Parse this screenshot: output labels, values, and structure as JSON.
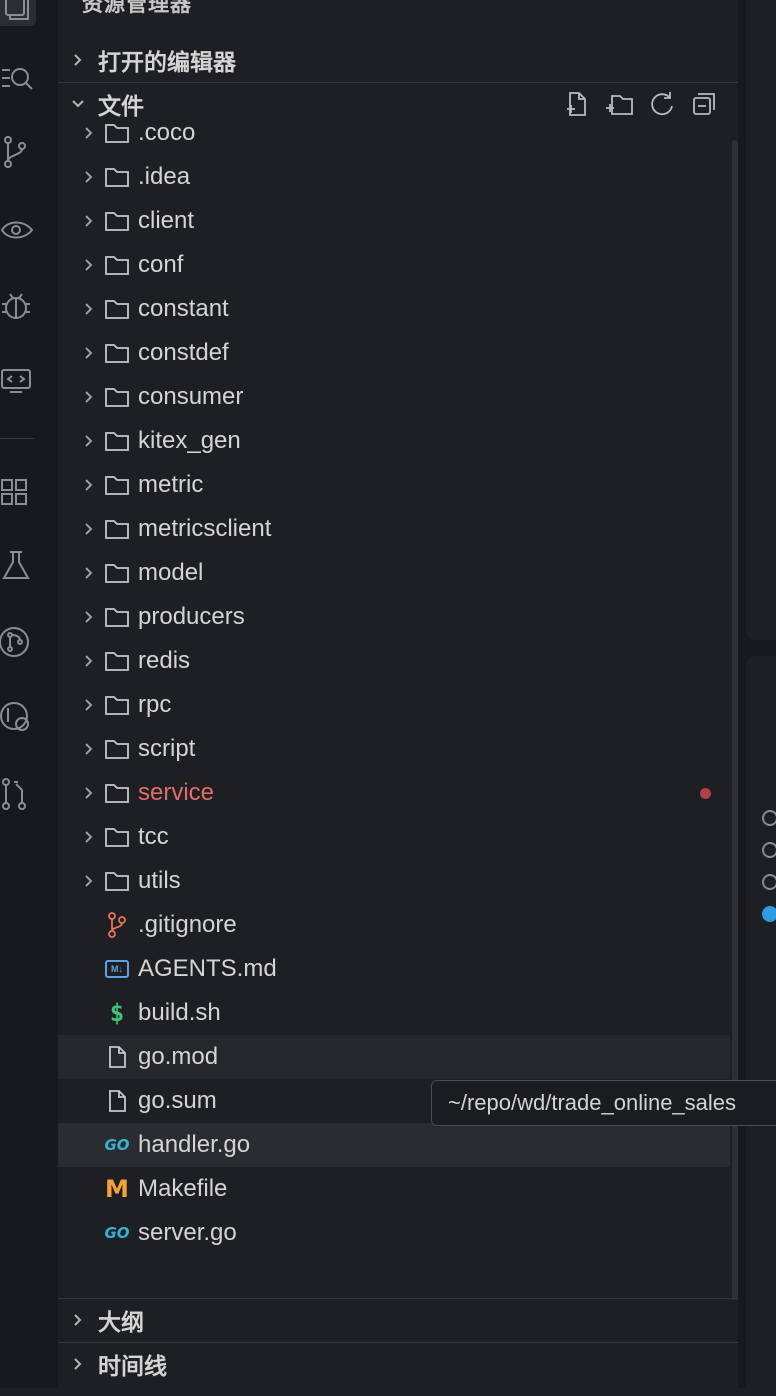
{
  "sidebar": {
    "title": "资源管理器",
    "sections": {
      "open_editors": "打开的编辑器",
      "files": "文件",
      "outline": "大纲",
      "timeline": "时间线"
    }
  },
  "tree": [
    {
      "label": ".coco",
      "type": "folder"
    },
    {
      "label": ".idea",
      "type": "folder"
    },
    {
      "label": "client",
      "type": "folder"
    },
    {
      "label": "conf",
      "type": "folder"
    },
    {
      "label": "constant",
      "type": "folder"
    },
    {
      "label": "constdef",
      "type": "folder"
    },
    {
      "label": "consumer",
      "type": "folder"
    },
    {
      "label": "kitex_gen",
      "type": "folder"
    },
    {
      "label": "metric",
      "type": "folder"
    },
    {
      "label": "metricsclient",
      "type": "folder"
    },
    {
      "label": "model",
      "type": "folder"
    },
    {
      "label": "producers",
      "type": "folder"
    },
    {
      "label": "redis",
      "type": "folder"
    },
    {
      "label": "rpc",
      "type": "folder"
    },
    {
      "label": "script",
      "type": "folder"
    },
    {
      "label": "service",
      "type": "folder",
      "modified": true
    },
    {
      "label": "tcc",
      "type": "folder"
    },
    {
      "label": "utils",
      "type": "folder"
    },
    {
      "label": ".gitignore",
      "type": "git"
    },
    {
      "label": "AGENTS.md",
      "type": "markdown"
    },
    {
      "label": "build.sh",
      "type": "shell"
    },
    {
      "label": "go.mod",
      "type": "file",
      "state": "hover"
    },
    {
      "label": "go.sum",
      "type": "file"
    },
    {
      "label": "handler.go",
      "type": "go",
      "state": "selected"
    },
    {
      "label": "Makefile",
      "type": "makefile"
    },
    {
      "label": "server.go",
      "type": "go"
    }
  ],
  "tooltip": "~/repo/wd/trade_online_sales",
  "icons": {
    "go": "GO",
    "makefile": "M",
    "shell": "$",
    "markdown": "M↓"
  },
  "colors": {
    "modified": "#e06c6c",
    "modified_dot": "#b0434a",
    "go": "#36b2d8",
    "makefile": "#f3a23a",
    "shell": "#3bc47a",
    "markdown": "#5ba3e8",
    "git": "#e8735a"
  }
}
